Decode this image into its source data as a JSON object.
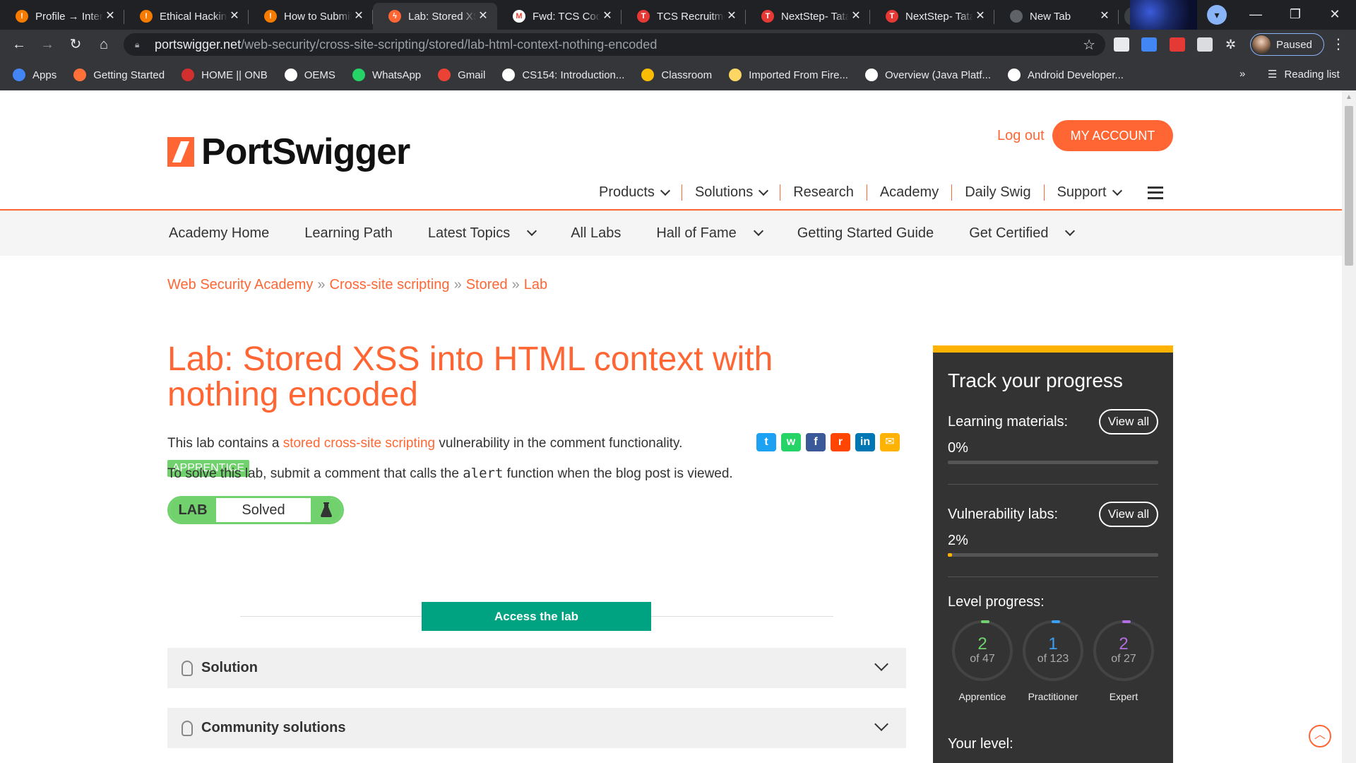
{
  "browser": {
    "tabs": [
      {
        "title": "Profile → Inter",
        "favicon_color": "#f57c00",
        "favicon_glyph": "!"
      },
      {
        "title": "Ethical Hacking",
        "favicon_color": "#f57c00",
        "favicon_glyph": "!"
      },
      {
        "title": "How to Submit",
        "favicon_color": "#f57c00",
        "favicon_glyph": "!"
      },
      {
        "title": "Lab: Stored XS",
        "favicon_color": "#ff6633",
        "favicon_glyph": "ϟ",
        "active": true
      },
      {
        "title": "Fwd: TCS Code",
        "favicon_color": "#ffffff",
        "favicon_glyph": "M"
      },
      {
        "title": "TCS Recruitme",
        "favicon_color": "#e53935",
        "favicon_glyph": "T"
      },
      {
        "title": "NextStep- Tata",
        "favicon_color": "#e53935",
        "favicon_glyph": "T"
      },
      {
        "title": "NextStep- Tata",
        "favicon_color": "#e53935",
        "favicon_glyph": "T"
      },
      {
        "title": "New Tab",
        "favicon_color": "#5f6368",
        "favicon_glyph": ""
      }
    ],
    "close_glyph": "✕",
    "newtab_glyph": "+",
    "url_host": "portswigger.net",
    "url_path": "/web-security/cross-site-scripting/stored/lab-html-context-nothing-encoded",
    "profile_status": "Paused",
    "bookmarks": [
      {
        "label": "Apps",
        "icon_color": "#4285f4"
      },
      {
        "label": "Getting Started",
        "icon_color": "#ff7139"
      },
      {
        "label": "HOME || ONB",
        "icon_color": "#d32f2f"
      },
      {
        "label": "OEMS",
        "icon_color": "#ffffff"
      },
      {
        "label": "WhatsApp",
        "icon_color": "#25d366"
      },
      {
        "label": "Gmail",
        "icon_color": "#ea4335"
      },
      {
        "label": "CS154: Introduction...",
        "icon_color": "#ffffff"
      },
      {
        "label": "Classroom",
        "icon_color": "#fbbc04"
      },
      {
        "label": "Imported From Fire...",
        "icon_color": "#fdd663"
      },
      {
        "label": "Overview (Java Platf...",
        "icon_color": "#ffffff"
      },
      {
        "label": "Android Developer...",
        "icon_color": "#ffffff"
      }
    ],
    "bookmarks_more": "»",
    "reading_list": "Reading list"
  },
  "header": {
    "logo_text": "PortSwigger",
    "logout": "Log out",
    "my_account": "MY ACCOUNT",
    "main_nav": [
      {
        "label": "Products",
        "dropdown": true
      },
      {
        "label": "Solutions",
        "dropdown": true
      },
      {
        "label": "Research",
        "dropdown": false
      },
      {
        "label": "Academy",
        "dropdown": false
      },
      {
        "label": "Daily Swig",
        "dropdown": false
      },
      {
        "label": "Support",
        "dropdown": true
      }
    ],
    "sub_nav": [
      {
        "label": "Academy Home",
        "dropdown": false
      },
      {
        "label": "Learning Path",
        "dropdown": false
      },
      {
        "label": "Latest Topics",
        "dropdown": true
      },
      {
        "label": "All Labs",
        "dropdown": false
      },
      {
        "label": "Hall of Fame",
        "dropdown": true
      },
      {
        "label": "Getting Started Guide",
        "dropdown": false
      },
      {
        "label": "Get Certified",
        "dropdown": true
      }
    ]
  },
  "breadcrumb": [
    "Web Security Academy",
    "Cross-site scripting",
    "Stored",
    "Lab"
  ],
  "breadcrumb_sep": "»",
  "lab": {
    "title": "Lab: Stored XSS into HTML context with nothing encoded",
    "level": "APPRENTICE",
    "status_label": "LAB",
    "status": "Solved",
    "desc_pre": "This lab contains a ",
    "desc_link": "stored cross-site scripting",
    "desc_post": " vulnerability in the comment functionality.",
    "task_pre": "To solve this lab, submit a comment that calls the ",
    "task_code": "alert",
    "task_post": " function when the blog post is viewed.",
    "access_button": "Access the lab",
    "accordions": [
      "Solution",
      "Community solutions"
    ]
  },
  "share": [
    {
      "name": "twitter-icon",
      "color": "#1da1f2",
      "glyph": "t"
    },
    {
      "name": "whatsapp-icon",
      "color": "#25d366",
      "glyph": "w"
    },
    {
      "name": "facebook-icon",
      "color": "#3b5998",
      "glyph": "f"
    },
    {
      "name": "reddit-icon",
      "color": "#ff4500",
      "glyph": "r"
    },
    {
      "name": "linkedin-icon",
      "color": "#0077b5",
      "glyph": "in"
    },
    {
      "name": "email-icon",
      "color": "#ffb300",
      "glyph": "✉"
    }
  ],
  "progress": {
    "title": "Track your progress",
    "learning_label": "Learning materials:",
    "learning_pct": "0%",
    "learning_fraction": 0,
    "labs_label": "Vulnerability labs:",
    "labs_pct": "2%",
    "labs_fraction": 0.02,
    "view_all": "View all",
    "level_label": "Level progress:",
    "levels": [
      {
        "count": "2",
        "of": "of 47",
        "name": "Apprentice",
        "color": "#70d16d"
      },
      {
        "count": "1",
        "of": "of 123",
        "name": "Practitioner",
        "color": "#3b9ff5"
      },
      {
        "count": "2",
        "of": "of 27",
        "name": "Expert",
        "color": "#b36ee0"
      }
    ],
    "your_level": "Your level:"
  }
}
